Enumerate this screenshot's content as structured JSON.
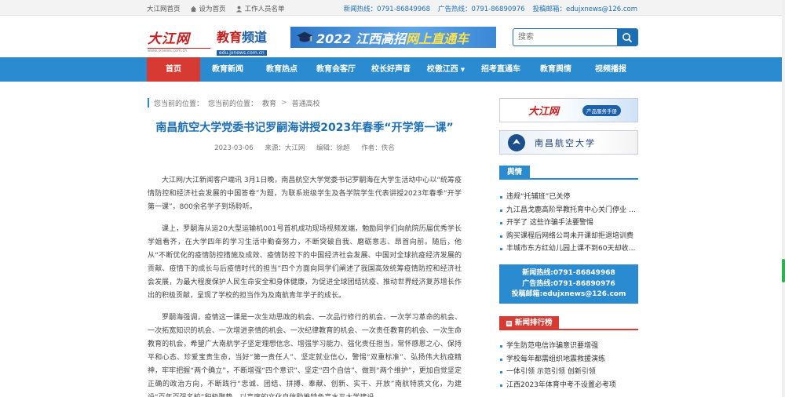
{
  "topbar": {
    "home": "大江网首页",
    "set_home": "设为首页",
    "staff_list": "工作人员名单",
    "news_hotline": "新闻热线：0791-86849968",
    "ad_hotline": "广告热线：0791-86890976",
    "email": "投稿邮箱：edujxnews@126.com"
  },
  "header": {
    "logo_main": "大江网",
    "logo_main_sub": "www.jxnews.com.cn",
    "logo_edu": "教育",
    "logo_edu_b": "频道",
    "logo_edu_sub": "edu.jxnews.com.cn",
    "banner_text_a": "2022 江西高招",
    "banner_text_b": "网上直通车",
    "search_placeholder": "搜索"
  },
  "nav": {
    "items": [
      {
        "label": "首页"
      },
      {
        "label": "教育新闻"
      },
      {
        "label": "教育热点"
      },
      {
        "label": "教育会客厅"
      },
      {
        "label": "校长好声音"
      },
      {
        "label": "校傲江西"
      },
      {
        "label": "招考直通车"
      },
      {
        "label": "教育舆情"
      },
      {
        "label": "视频播报"
      }
    ]
  },
  "breadcrumb": {
    "prefix": "您当前的位置：",
    "prefix2": "您当前的位置：",
    "level1": "教育",
    "sep": ">",
    "level2": "普通高校"
  },
  "article": {
    "title": "南昌航空大学党委书记罗嗣海讲授2023年春季“开学第一课”",
    "date": "2023-03-06",
    "source": "来源：大江网",
    "editor": "编辑：徐超",
    "author": "作者：佚名",
    "paragraphs": [
      "大江网/大江新闻客户端讯 3月1日晚，南昌航空大学党委书记罗嗣海在大学生活动中心以“统筹疫情防控和经济社会发展的中国答卷”为题，为联系班级学生及各学院学生代表讲授2023年春季“开学第一课”，800余名学子到场聆听。",
      "课上，罗嗣海从运20大型运输机001号首机成功现场视频发端，勉励同学们向航院历届优秀学长学姐看齐，在大学四年的学习生活中勤奋努力，不断突破自我、磨砺意志、昂首向前。随后，他从“不断优化的疫情防控措施及成效、疫情防控下的中国经济社会发展、中国对全球抗疫经济发展的贡献、疫情下的成长与后疫情时代的担当”四个方面向同学们阐述了我国高效统筹疫情防控和经济社会发展，为最大程度保护人民生命安全和身体健康，为促进全球团结抗疫、推动世界经济复苏增长作出的积极贡献，呈现了学校的担当作为及南航青年学子的成长。",
      "罗嗣海强调，疫情这一课是一次生动思政的机会、一次品行修行的机会、一次学习革命的机会、一次拓宽知识的机会、一次增进亲情的机会、一次纪律教育的机会、一次责任教育的机会、一次生命教育的机会，希望广大南航学子坚定理想信念、增强学习能力、强化责任担当，常怀感恩之心、保持平和心态、珍爱宝贵生命，当好“第一责任人”、坚定就业信心，警惕“双重标准”、弘扬伟大抗疫精神，牢牢把握“两个确立”，不断增强“四个意识”、坚定“四个自信”、做到“两个维护”，更加自觉坚定正确的政治方向，不断践行“忠诚、团结、拼搏、奉献、创新、实干、开放”南航特质文化，为建设“百年百强名校”积极聚势，以高度的文化自信助推特色高水平大学建设。"
    ]
  },
  "sidebar": {
    "ad1_logo": "大江网",
    "ad1_badge": "产品服务手册",
    "ad2_text": "南昌航空大学",
    "opinion_title": "舆情",
    "opinion_items": [
      "违规“托辅班”已关停",
      "九江昌戈鹿高阶早教托育中心关门停业 家...",
      "开学了 这些诈骗手法要警惕",
      "购买课程后网络公司未开课却拒退培训费",
      "丰城市东方红幼儿园上课不到60天却收88..."
    ],
    "contact": {
      "news": "新闻热线:0791-86849968",
      "ad": "广告热线:0791-86890976",
      "email": "投稿邮箱:edujxnews@126.com"
    },
    "rank_title": "新闻排行榜",
    "rank_items": [
      "学生防范电信诈骗意识要增强",
      "学校每年都需组织地震救援演练",
      "一体引领 示范引领 创新引领",
      "江西2023年体育中考不设置必考项"
    ]
  },
  "colors": {
    "nav_blue": "#2a8bd0",
    "active_red": "#d63a32",
    "title_blue": "#1d6fb5"
  }
}
